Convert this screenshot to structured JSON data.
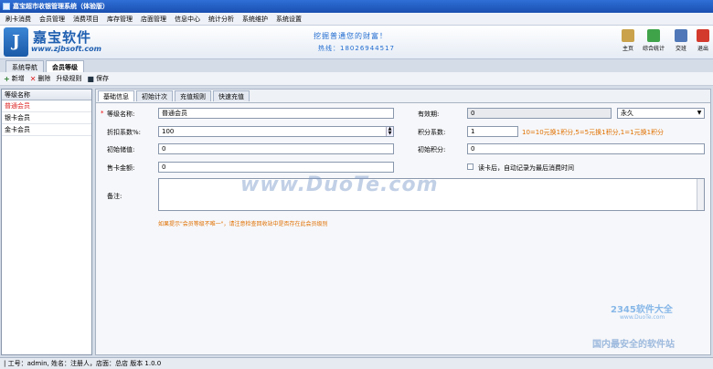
{
  "window": {
    "title": "嘉宝超市收银管理系统（体验版）"
  },
  "menu": [
    "刷卡消费",
    "会员管理",
    "消费项目",
    "库存管理",
    "店面管理",
    "信息中心",
    "统计分析",
    "系统维护",
    "系统设置"
  ],
  "banner": {
    "logo_letter": "J",
    "brand": "嘉宝软件",
    "url": "www.zjbsoft.com",
    "slogan": "挖掘普通您的财富！",
    "phone": "热线：18026944517",
    "buttons": [
      {
        "label": "主页",
        "color": "#c9a24b"
      },
      {
        "label": "综合统计",
        "color": "#3fa34a"
      },
      {
        "label": "交班",
        "color": "#5078b8"
      },
      {
        "label": "退出",
        "color": "#d33a2c"
      }
    ]
  },
  "nav_tabs": [
    "系统导航",
    "会员等级"
  ],
  "toolbar": {
    "add": "新增",
    "delete": "删除",
    "upgrade": "升级规则",
    "save": "保存"
  },
  "level_list": {
    "header": "等级名称",
    "items": [
      "普通会员",
      "银卡会员",
      "金卡会员"
    ]
  },
  "sub_tabs": [
    "基础信息",
    "初始计次",
    "充值规则",
    "快速充值"
  ],
  "form": {
    "level_name_label": "等级名称:",
    "level_name": "普通会员",
    "validity_label": "有效期:",
    "validity_value": "0",
    "validity_unit": "永久",
    "discount_label": "折扣系数%:",
    "discount": "100",
    "points_label": "积分系数:",
    "points": "1",
    "points_hint": "10=10元换1积分,5=5元换1积分,1=1元换1积分",
    "init_stored_label": "初始储值:",
    "init_stored": "0",
    "init_points_label": "初始积分:",
    "init_points": "0",
    "card_fee_label": "售卡金额:",
    "card_fee": "0",
    "auto_record_label": "读卡后，自动记录为最后消费时间",
    "remark_label": "备注:",
    "remark": "",
    "warning": "如果提示\"会员等级不唯一\"，请注意检查回收站中是否存在此会员级别"
  },
  "watermark": {
    "main": "www.DuoTe.com",
    "logo2": "2345软件大全",
    "logo2_url": "www.DuoTe.com",
    "bottom": "国内最安全的软件站"
  },
  "status": "| 工号：admin, 姓名：注册人，店面：总店   版本 1.0.0"
}
